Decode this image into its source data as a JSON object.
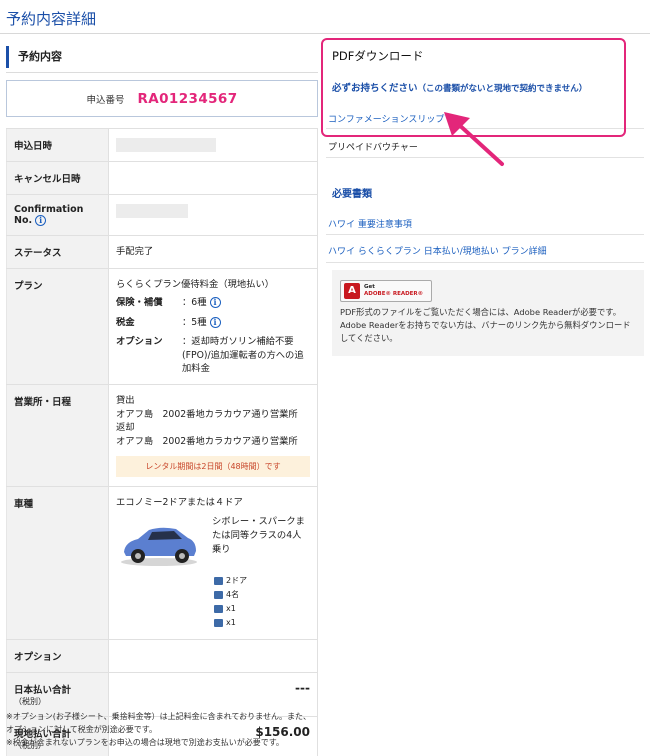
{
  "page_title": "予約内容詳細",
  "section_title": "予約内容",
  "application": {
    "label": "申込番号",
    "number": "RA01234567"
  },
  "rows": {
    "applied_date": "申込日時",
    "cancel_date": "キャンセル日時",
    "confirmation_no": "Confirmation No.",
    "status_label": "ステータス",
    "status_value": "手配完了",
    "plan_label": "プラン",
    "plan_name": "らくらくプラン優待料金（現地払い）",
    "plan_insurance_label": "保険・補償",
    "plan_insurance_value": "：6種",
    "plan_tax_label": "税金",
    "plan_tax_value": "：5種",
    "plan_option_label": "オプション",
    "plan_option_value": "：返却時ガソリン補給不要(FPO)/追加運転者の方への追加料金",
    "office_label": "営業所・日程",
    "pickup_label": "貸出",
    "pickup_office": "オアフ島　2002番地カラカウア通り営業所",
    "return_label": "返却",
    "return_office": "オアフ島　2002番地カラカウア通り営業所",
    "rental_note": "レンタル期間は2日間（48時間）です",
    "car_label": "車種",
    "car_class": "エコノミー2ドアまたは４ドア",
    "car_desc": "シボレー・スパークまたは同等クラスの4人乗り",
    "car_specs": [
      "2ドア",
      "4名",
      "x1",
      "x1"
    ],
    "options_label": "オプション",
    "japan_total_label": "日本払い合計",
    "japan_total_suffix": "（税別）",
    "japan_total_value": "---",
    "local_total_label": "現地払い合計",
    "local_total_suffix": "（税別）",
    "local_total_value": "$156.00"
  },
  "footnotes": [
    "※オプション(お子様シート、乗捨料金等）は上記料金に含まれておりません。また、オプションに対して税金が別途必要です。",
    "※税金が含まれないプランをお申込の場合は現地で別途お支払いが必要です。"
  ],
  "pdf": {
    "title": "PDFダウンロード",
    "warning": "必ずお持ちください",
    "warning_sub": "（この書類がないと現地で契約できません）",
    "confirmation_slip": "コンファメーションスリップ",
    "prepaid_voucher": "プリペイドバウチャー"
  },
  "required_docs": {
    "title": "必要書類",
    "links": [
      "ハワイ 重要注意事項",
      "ハワイ らくらくプラン 日本払い/現地払い プラン詳細"
    ]
  },
  "adobe": {
    "badge_top": "Get",
    "badge_bottom": "ADOBE® READER®",
    "desc": "PDF形式のファイルをご覧いただく場合には、Adobe Readerが必要です。Adobe Readerをお持ちでない方は、バナーのリンク先から無料ダウンロードしてください。"
  },
  "colors": {
    "accent": "#1b4fa8",
    "highlight": "#e3267a",
    "price_note": "#c8462a"
  }
}
